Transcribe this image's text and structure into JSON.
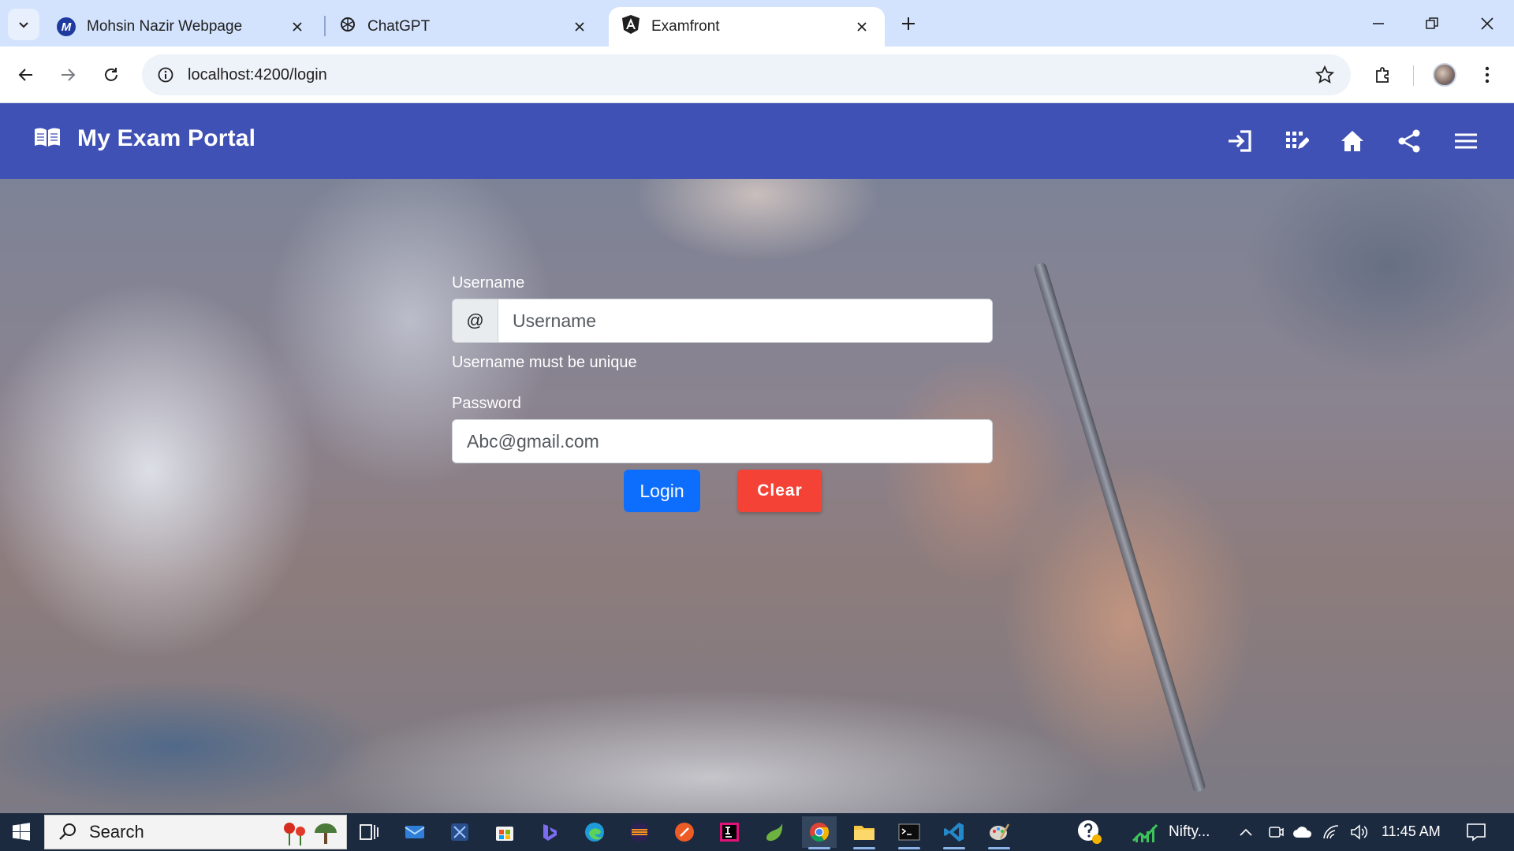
{
  "browser": {
    "tabs": [
      {
        "title": "Mohsin Nazir Webpage",
        "favicon": "m-logo-icon",
        "active": false
      },
      {
        "title": "ChatGPT",
        "favicon": "chatgpt-icon",
        "active": false
      },
      {
        "title": "Examfront",
        "favicon": "angular-icon",
        "active": true
      }
    ],
    "url": "localhost:4200/login"
  },
  "app": {
    "brand_title": "My Exam Portal",
    "nav_icons": [
      "login-icon",
      "dashboard-icon",
      "home-icon",
      "share-icon",
      "menu-icon"
    ],
    "nav_color": "#3f51b5"
  },
  "form": {
    "username_label": "Username",
    "username_addon": "@",
    "username_placeholder": "Username",
    "username_help": "Username must be unique",
    "password_label": "Password",
    "password_placeholder": "Abc@gmail.com",
    "login_label": "Login",
    "clear_label": "Clear"
  },
  "taskbar": {
    "search_text": "Search",
    "tray_app_label": "Nifty...",
    "clock": "11:45 AM"
  }
}
